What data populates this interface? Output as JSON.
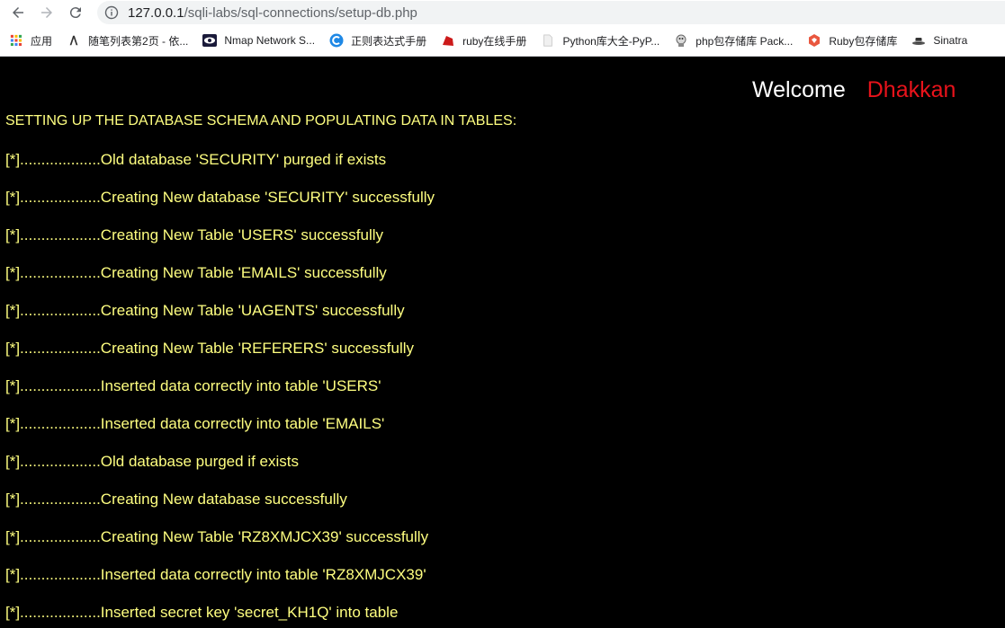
{
  "browser": {
    "url_host": "127.0.0.1",
    "url_path": "/sqli-labs/sql-connections/setup-db.php",
    "bookmarks": [
      {
        "label": "应用",
        "icon": "apps-grid-icon"
      },
      {
        "label": "随笔列表第2页 - 依...",
        "icon": "blog-icon"
      },
      {
        "label": "Nmap Network S...",
        "icon": "nmap-eye-icon"
      },
      {
        "label": "正则表达式手册",
        "icon": "regex-c-icon"
      },
      {
        "label": "ruby在线手册",
        "icon": "ruby-gem-icon"
      },
      {
        "label": "Python库大全-PyP...",
        "icon": "page-icon"
      },
      {
        "label": "php包存储库 Pack...",
        "icon": "composer-icon"
      },
      {
        "label": "Ruby包存储库",
        "icon": "rubygems-icon"
      },
      {
        "label": "Sinatra",
        "icon": "sinatra-hat-icon"
      }
    ]
  },
  "page": {
    "welcome": "Welcome",
    "user": "Dhakkan",
    "heading": "SETTING UP THE DATABASE SCHEMA AND POPULATING DATA IN TABLES:",
    "lines": [
      "[*]...................Old database 'SECURITY' purged if exists",
      "[*]...................Creating New database 'SECURITY' successfully",
      "[*]...................Creating New Table 'USERS' successfully",
      "[*]...................Creating New Table 'EMAILS' successfully",
      "[*]...................Creating New Table 'UAGENTS' successfully",
      "[*]...................Creating New Table 'REFERERS' successfully",
      "[*]...................Inserted data correctly into table 'USERS'",
      "[*]...................Inserted data correctly into table 'EMAILS'",
      "[*]...................Old database purged if exists",
      "[*]...................Creating New database successfully",
      "[*]...................Creating New Table 'RZ8XMJCX39' successfully",
      "[*]...................Inserted data correctly into table 'RZ8XMJCX39'",
      "[*]...................Inserted secret key 'secret_KH1Q' into table"
    ],
    "colors": {
      "text": "#ffff80",
      "accent": "#e8131b",
      "background": "#000000"
    }
  }
}
